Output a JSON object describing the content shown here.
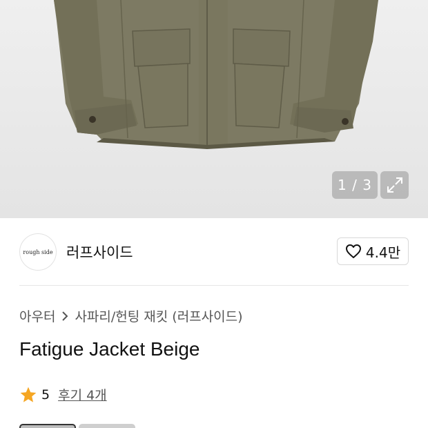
{
  "hero": {
    "pager_current": "1",
    "pager_total": "3",
    "pager_text": "1 / 3",
    "image_icon": "jacket-photo",
    "expand_icon": "expand-icon"
  },
  "brand": {
    "logo_text": "rough side",
    "name": "러프사이드",
    "like_count": "4.4만",
    "like_icon": "heart-icon"
  },
  "breadcrumb": {
    "items": [
      "아우터",
      "사파리/헌팅 재킷 (러프사이드)"
    ],
    "separator_icon": "chevron-right-icon"
  },
  "product": {
    "title": "Fatigue Jacket Beige"
  },
  "rating": {
    "score": "5",
    "reviews_label": "후기 4개",
    "star_color": "#f5a623",
    "star_icon": "star-icon"
  },
  "colors": {
    "jacket": "#7d7a63",
    "pager_bg": "#969696"
  }
}
